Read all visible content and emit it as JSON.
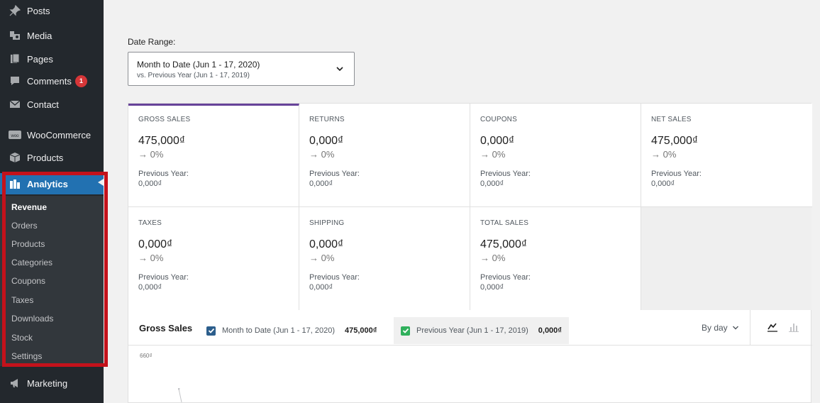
{
  "sidebar": {
    "items": [
      {
        "key": "posts",
        "label": "Posts",
        "icon": "pin-icon"
      },
      {
        "key": "media",
        "label": "Media",
        "icon": "media-icon"
      },
      {
        "key": "pages",
        "label": "Pages",
        "icon": "pages-icon"
      },
      {
        "key": "comments",
        "label": "Comments",
        "icon": "comment-icon",
        "badge": "1"
      },
      {
        "key": "contact",
        "label": "Contact",
        "icon": "mail-icon"
      },
      {
        "key": "woocommerce",
        "label": "WooCommerce",
        "icon": "woo-icon"
      },
      {
        "key": "products",
        "label": "Products",
        "icon": "box-icon"
      },
      {
        "key": "analytics",
        "label": "Analytics",
        "icon": "bar-chart-icon"
      },
      {
        "key": "marketing",
        "label": "Marketing",
        "icon": "megaphone-icon"
      }
    ],
    "submenu": [
      {
        "label": "Revenue",
        "active": true
      },
      {
        "label": "Orders"
      },
      {
        "label": "Products"
      },
      {
        "label": "Categories"
      },
      {
        "label": "Coupons"
      },
      {
        "label": "Taxes"
      },
      {
        "label": "Downloads"
      },
      {
        "label": "Stock"
      },
      {
        "label": "Settings"
      }
    ]
  },
  "date_range": {
    "label": "Date Range:",
    "primary": "Month to Date (Jun 1 - 17, 2020)",
    "secondary": "vs. Previous Year (Jun 1 - 17, 2019)"
  },
  "stats": [
    {
      "title": "GROSS SALES",
      "value": "475,000₫",
      "delta": "→ 0%",
      "prev_label": "Previous Year:",
      "prev_value": "0,000₫",
      "selected": true
    },
    {
      "title": "RETURNS",
      "value": "0,000₫",
      "delta": "→ 0%",
      "prev_label": "Previous Year:",
      "prev_value": "0,000₫"
    },
    {
      "title": "COUPONS",
      "value": "0,000₫",
      "delta": "→ 0%",
      "prev_label": "Previous Year:",
      "prev_value": "0,000₫"
    },
    {
      "title": "NET SALES",
      "value": "475,000₫",
      "delta": "→ 0%",
      "prev_label": "Previous Year:",
      "prev_value": "0,000₫"
    },
    {
      "title": "TAXES",
      "value": "0,000₫",
      "delta": "→ 0%",
      "prev_label": "Previous Year:",
      "prev_value": "0,000₫"
    },
    {
      "title": "SHIPPING",
      "value": "0,000₫",
      "delta": "→ 0%",
      "prev_label": "Previous Year:",
      "prev_value": "0,000₫"
    },
    {
      "title": "TOTAL SALES",
      "value": "475,000₫",
      "delta": "→ 0%",
      "prev_label": "Previous Year:",
      "prev_value": "0,000₫"
    }
  ],
  "chart": {
    "title": "Gross Sales",
    "current_legend": "Month to Date (Jun 1 - 17, 2020)",
    "current_amount": "475,000₫",
    "current_color": "#2c5e8c",
    "previous_legend": "Previous Year (Jun 1 - 17, 2019)",
    "previous_amount": "0,000₫",
    "previous_color": "#30b05c",
    "interval": "By day",
    "y_tick": "660₫",
    "line_chart_icon": "line-chart-icon",
    "bar_chart_icon": "bar-chart-icon"
  }
}
